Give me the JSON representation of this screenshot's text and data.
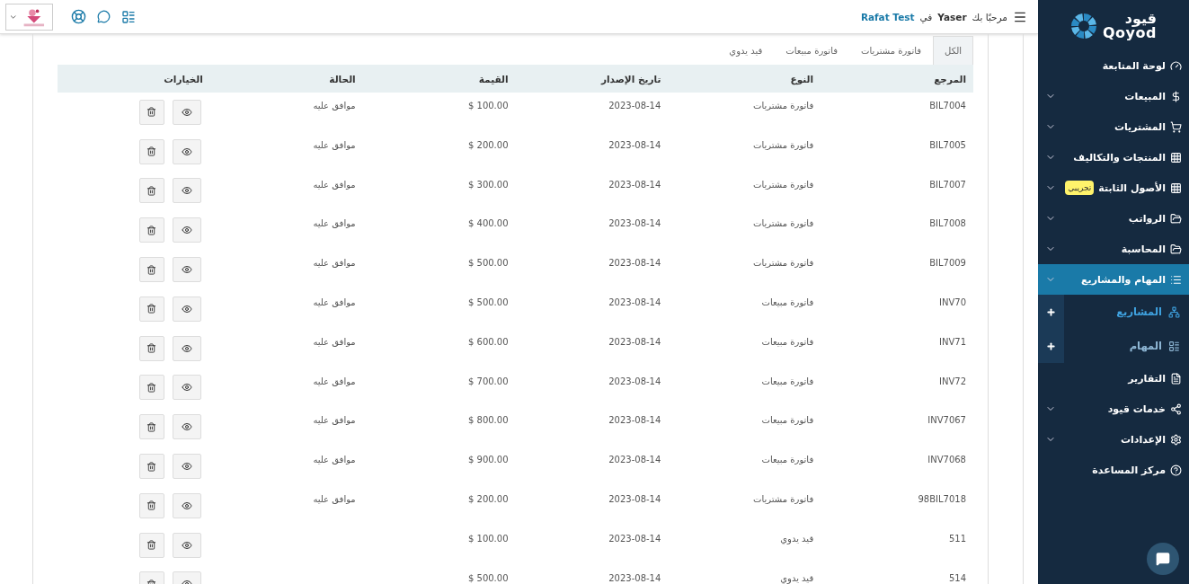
{
  "sidebar": {
    "logo": {
      "arabic": "قيود",
      "latin": "Qoyod"
    },
    "items": [
      {
        "label": "لوحة المتابعة",
        "expandable": false,
        "selected": false
      },
      {
        "label": "المبيعات",
        "expandable": true,
        "selected": false
      },
      {
        "label": "المشتريات",
        "expandable": true,
        "selected": false
      },
      {
        "label": "المنتجات والتكاليف",
        "expandable": true,
        "selected": false
      },
      {
        "label": "الأصول الثابتة",
        "badge": "تجريبي",
        "expandable": true,
        "selected": false
      },
      {
        "label": "الرواتب",
        "expandable": true,
        "selected": false
      },
      {
        "label": "المحاسبة",
        "expandable": true,
        "selected": false
      },
      {
        "label": "المهام والمشاريع",
        "expandable": true,
        "selected": true,
        "children": [
          {
            "label": "المشاريع",
            "selected": true
          },
          {
            "label": "المهام",
            "selected": false
          }
        ]
      },
      {
        "label": "التقارير",
        "expandable": false,
        "selected": false
      },
      {
        "label": "خدمات قيود",
        "expandable": true,
        "selected": false
      },
      {
        "label": "الإعدادات",
        "expandable": true,
        "selected": false
      },
      {
        "label": "مركز المساعدة",
        "expandable": false,
        "selected": false
      }
    ]
  },
  "topbar": {
    "greeting": "مرحبًا بك",
    "user": "Yaser",
    "connector": "في",
    "company": "Rafat Test"
  },
  "tabs": [
    {
      "label": "الكل",
      "selected": true
    },
    {
      "label": "فاتورة مشتريات",
      "selected": false
    },
    {
      "label": "فاتورة مبيعات",
      "selected": false
    },
    {
      "label": "قيد يدوي",
      "selected": false
    }
  ],
  "table": {
    "columns": [
      "المرجع",
      "النوع",
      "تاريخ الإصدار",
      "القيمة",
      "الحالة",
      "الخيارات"
    ],
    "rows": [
      {
        "ref": "BIL7004",
        "type": "فاتورة مشتريات",
        "date": "2023-08-14",
        "value": "$ 100.00",
        "status": "موافق عليه"
      },
      {
        "ref": "BIL7005",
        "type": "فاتورة مشتريات",
        "date": "2023-08-14",
        "value": "$ 200.00",
        "status": "موافق عليه"
      },
      {
        "ref": "BIL7007",
        "type": "فاتورة مشتريات",
        "date": "2023-08-14",
        "value": "$ 300.00",
        "status": "موافق عليه"
      },
      {
        "ref": "BIL7008",
        "type": "فاتورة مشتريات",
        "date": "2023-08-14",
        "value": "$ 400.00",
        "status": "موافق عليه"
      },
      {
        "ref": "BIL7009",
        "type": "فاتورة مشتريات",
        "date": "2023-08-14",
        "value": "$ 500.00",
        "status": "موافق عليه"
      },
      {
        "ref": "INV70",
        "type": "فاتورة مبيعات",
        "date": "2023-08-14",
        "value": "$ 500.00",
        "status": "موافق عليه"
      },
      {
        "ref": "INV71",
        "type": "فاتورة مبيعات",
        "date": "2023-08-14",
        "value": "$ 600.00",
        "status": "موافق عليه"
      },
      {
        "ref": "INV72",
        "type": "فاتورة مبيعات",
        "date": "2023-08-14",
        "value": "$ 700.00",
        "status": "موافق عليه"
      },
      {
        "ref": "INV7067",
        "type": "فاتورة مبيعات",
        "date": "2023-08-14",
        "value": "$ 800.00",
        "status": "موافق عليه"
      },
      {
        "ref": "INV7068",
        "type": "فاتورة مبيعات",
        "date": "2023-08-14",
        "value": "$ 900.00",
        "status": "موافق عليه"
      },
      {
        "ref": "98BIL7018",
        "type": "فاتورة مشتريات",
        "date": "2023-08-14",
        "value": "$ 200.00",
        "status": "موافق عليه"
      },
      {
        "ref": "511",
        "type": "قيد يدوي",
        "date": "2023-08-14",
        "value": "$ 100.00"
      },
      {
        "ref": "514",
        "type": "قيد يدوي",
        "date": "2023-08-14",
        "value": "$ 500.00"
      }
    ]
  }
}
